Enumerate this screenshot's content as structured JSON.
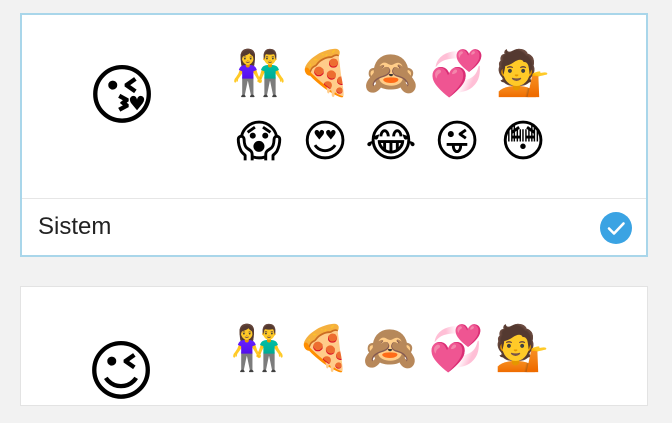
{
  "accent_color": "#3aa3e3",
  "options": [
    {
      "label": "Sistem",
      "selected": true,
      "big_emoji": "😘",
      "emojis": [
        "👫",
        "🍕",
        "🙈",
        "💞",
        "💁",
        "😱",
        "😍",
        "😂",
        "😜",
        "😳"
      ]
    },
    {
      "big_emoji": "😉",
      "emojis": [
        "👫",
        "🍕",
        "🙈",
        "💞",
        "💁"
      ]
    }
  ]
}
